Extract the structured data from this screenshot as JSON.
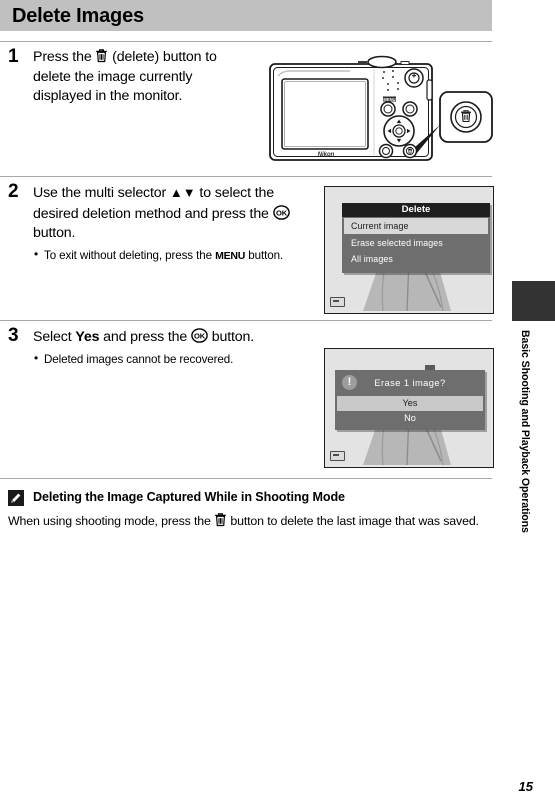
{
  "header": {
    "title": "Delete Images"
  },
  "steps": [
    {
      "number": "1",
      "text_before": "Press the ",
      "icon": "trash-icon",
      "text_after": " (delete) button to delete the image currently displayed in the monitor.",
      "bullets": []
    },
    {
      "number": "2",
      "text_a": "Use the multi selector ",
      "arrows": "▲▼",
      "text_b": " to select the desired deletion method and press the ",
      "icon": "ok-button-icon",
      "text_c": " button.",
      "bullets": [
        {
          "pre": "To exit without deleting, press the ",
          "emph": "MENU",
          "post": " button."
        }
      ]
    },
    {
      "number": "3",
      "text_a": "Select ",
      "emph": "Yes",
      "text_b": " and press the ",
      "icon": "ok-button-icon",
      "text_c": " button.",
      "bullets": [
        {
          "pre": "Deleted images cannot be recovered.",
          "emph": "",
          "post": ""
        }
      ]
    }
  ],
  "camera": {
    "brand": "Nikon",
    "menu_button_label": "MENU",
    "callout_icon": "trash-icon"
  },
  "screen_step2": {
    "menu_title": "Delete",
    "items": [
      {
        "label": "Current image",
        "selected": true
      },
      {
        "label": "Erase selected images",
        "selected": false
      },
      {
        "label": "All images",
        "selected": false
      }
    ],
    "battery_icon": "battery-icon"
  },
  "screen_step3": {
    "warn_icon": "!",
    "message": "Erase 1  image?",
    "options": [
      {
        "label": "Yes",
        "selected": true
      },
      {
        "label": "No",
        "selected": false
      }
    ],
    "battery_icon": "battery-icon"
  },
  "note": {
    "icon": "pencil-note-icon",
    "title": "Deleting the Image Captured While in Shooting Mode",
    "text_before": "When using shooting mode, press the ",
    "icon_inline": "trash-icon",
    "text_after": " button to delete the last image that was saved."
  },
  "sidebar": {
    "chapter_label": "Basic Shooting and Playback Operations"
  },
  "footer": {
    "page_number": "15"
  },
  "colors": {
    "header_bg": "#c0c0c0",
    "rule": "#a8a8a8",
    "tab": "#333333",
    "menu_head": "#1f1f1f",
    "menu_bg": "#6e6e6e",
    "selected": "#d8d8d8",
    "screen_bg": "#e6e6e6"
  }
}
